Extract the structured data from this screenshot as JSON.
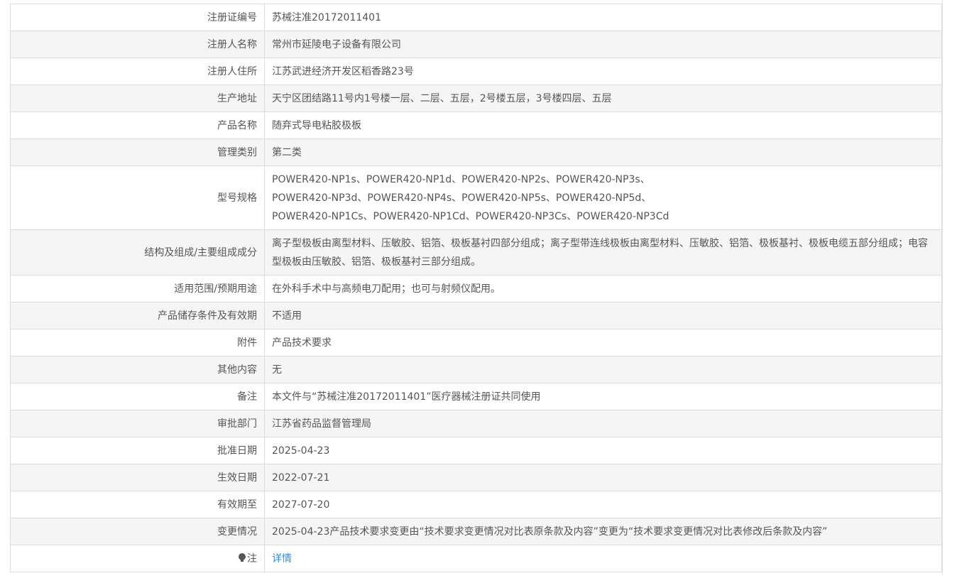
{
  "rows": [
    {
      "label": "注册证编号",
      "value": "苏械注准20172011401"
    },
    {
      "label": "注册人名称",
      "value": "常州市延陵电子设备有限公司"
    },
    {
      "label": "注册人住所",
      "value": "江苏武进经济开发区稻香路23号"
    },
    {
      "label": "生产地址",
      "value": "天宁区团结路11号内1号楼一层、二层、五层，2号楼五层，3号楼四层、五层"
    },
    {
      "label": "产品名称",
      "value": "随弃式导电粘胶极板"
    },
    {
      "label": "管理类别",
      "value": "第二类"
    },
    {
      "label": "型号规格",
      "value_lines": [
        "POWER420-NP1s、POWER420-NP1d、POWER420-NP2s、POWER420-NP3s、",
        "POWER420-NP3d、POWER420-NP4s、POWER420-NP5s、POWER420-NP5d、",
        "POWER420-NP1Cs、POWER420-NP1Cd、POWER420-NP3Cs、POWER420-NP3Cd"
      ]
    },
    {
      "label": "结构及组成/主要组成成分",
      "value": "离子型极板由离型材料、压敏胶、铝箔、极板基衬四部分组成；离子型带连线极板由离型材料、压敏胶、铝箔、极板基衬、极板电缆五部分组成；电容型极板由压敏胶、铝箔、极板基衬三部分组成。"
    },
    {
      "label": "适用范围/预期用途",
      "value": "在外科手术中与高频电刀配用；也可与射频仪配用。"
    },
    {
      "label": "产品储存条件及有效期",
      "value": "不适用"
    },
    {
      "label": "附件",
      "value": "产品技术要求"
    },
    {
      "label": "其他内容",
      "value": "无"
    },
    {
      "label": "备注",
      "value": "本文件与“苏械注准20172011401”医疗器械注册证共同使用"
    },
    {
      "label": "审批部门",
      "value": "江苏省药品监督管理局"
    },
    {
      "label": "批准日期",
      "value": "2025-04-23"
    },
    {
      "label": "生效日期",
      "value": "2022-07-21"
    },
    {
      "label": "有效期至",
      "value": "2027-07-20"
    },
    {
      "label": "变更情况",
      "value": "2025-04-23产品技术要求变更由“技术要求变更情况对比表原条款及内容”变更为“技术要求变更情况对比表修改后条款及内容”"
    },
    {
      "label": "注",
      "link": "详情",
      "icon": "bulb-icon"
    }
  ],
  "colors": {
    "text": "#555555",
    "border": "#dcdcdc",
    "stripe": "#f5f5f5",
    "link": "#2d8cf0"
  }
}
